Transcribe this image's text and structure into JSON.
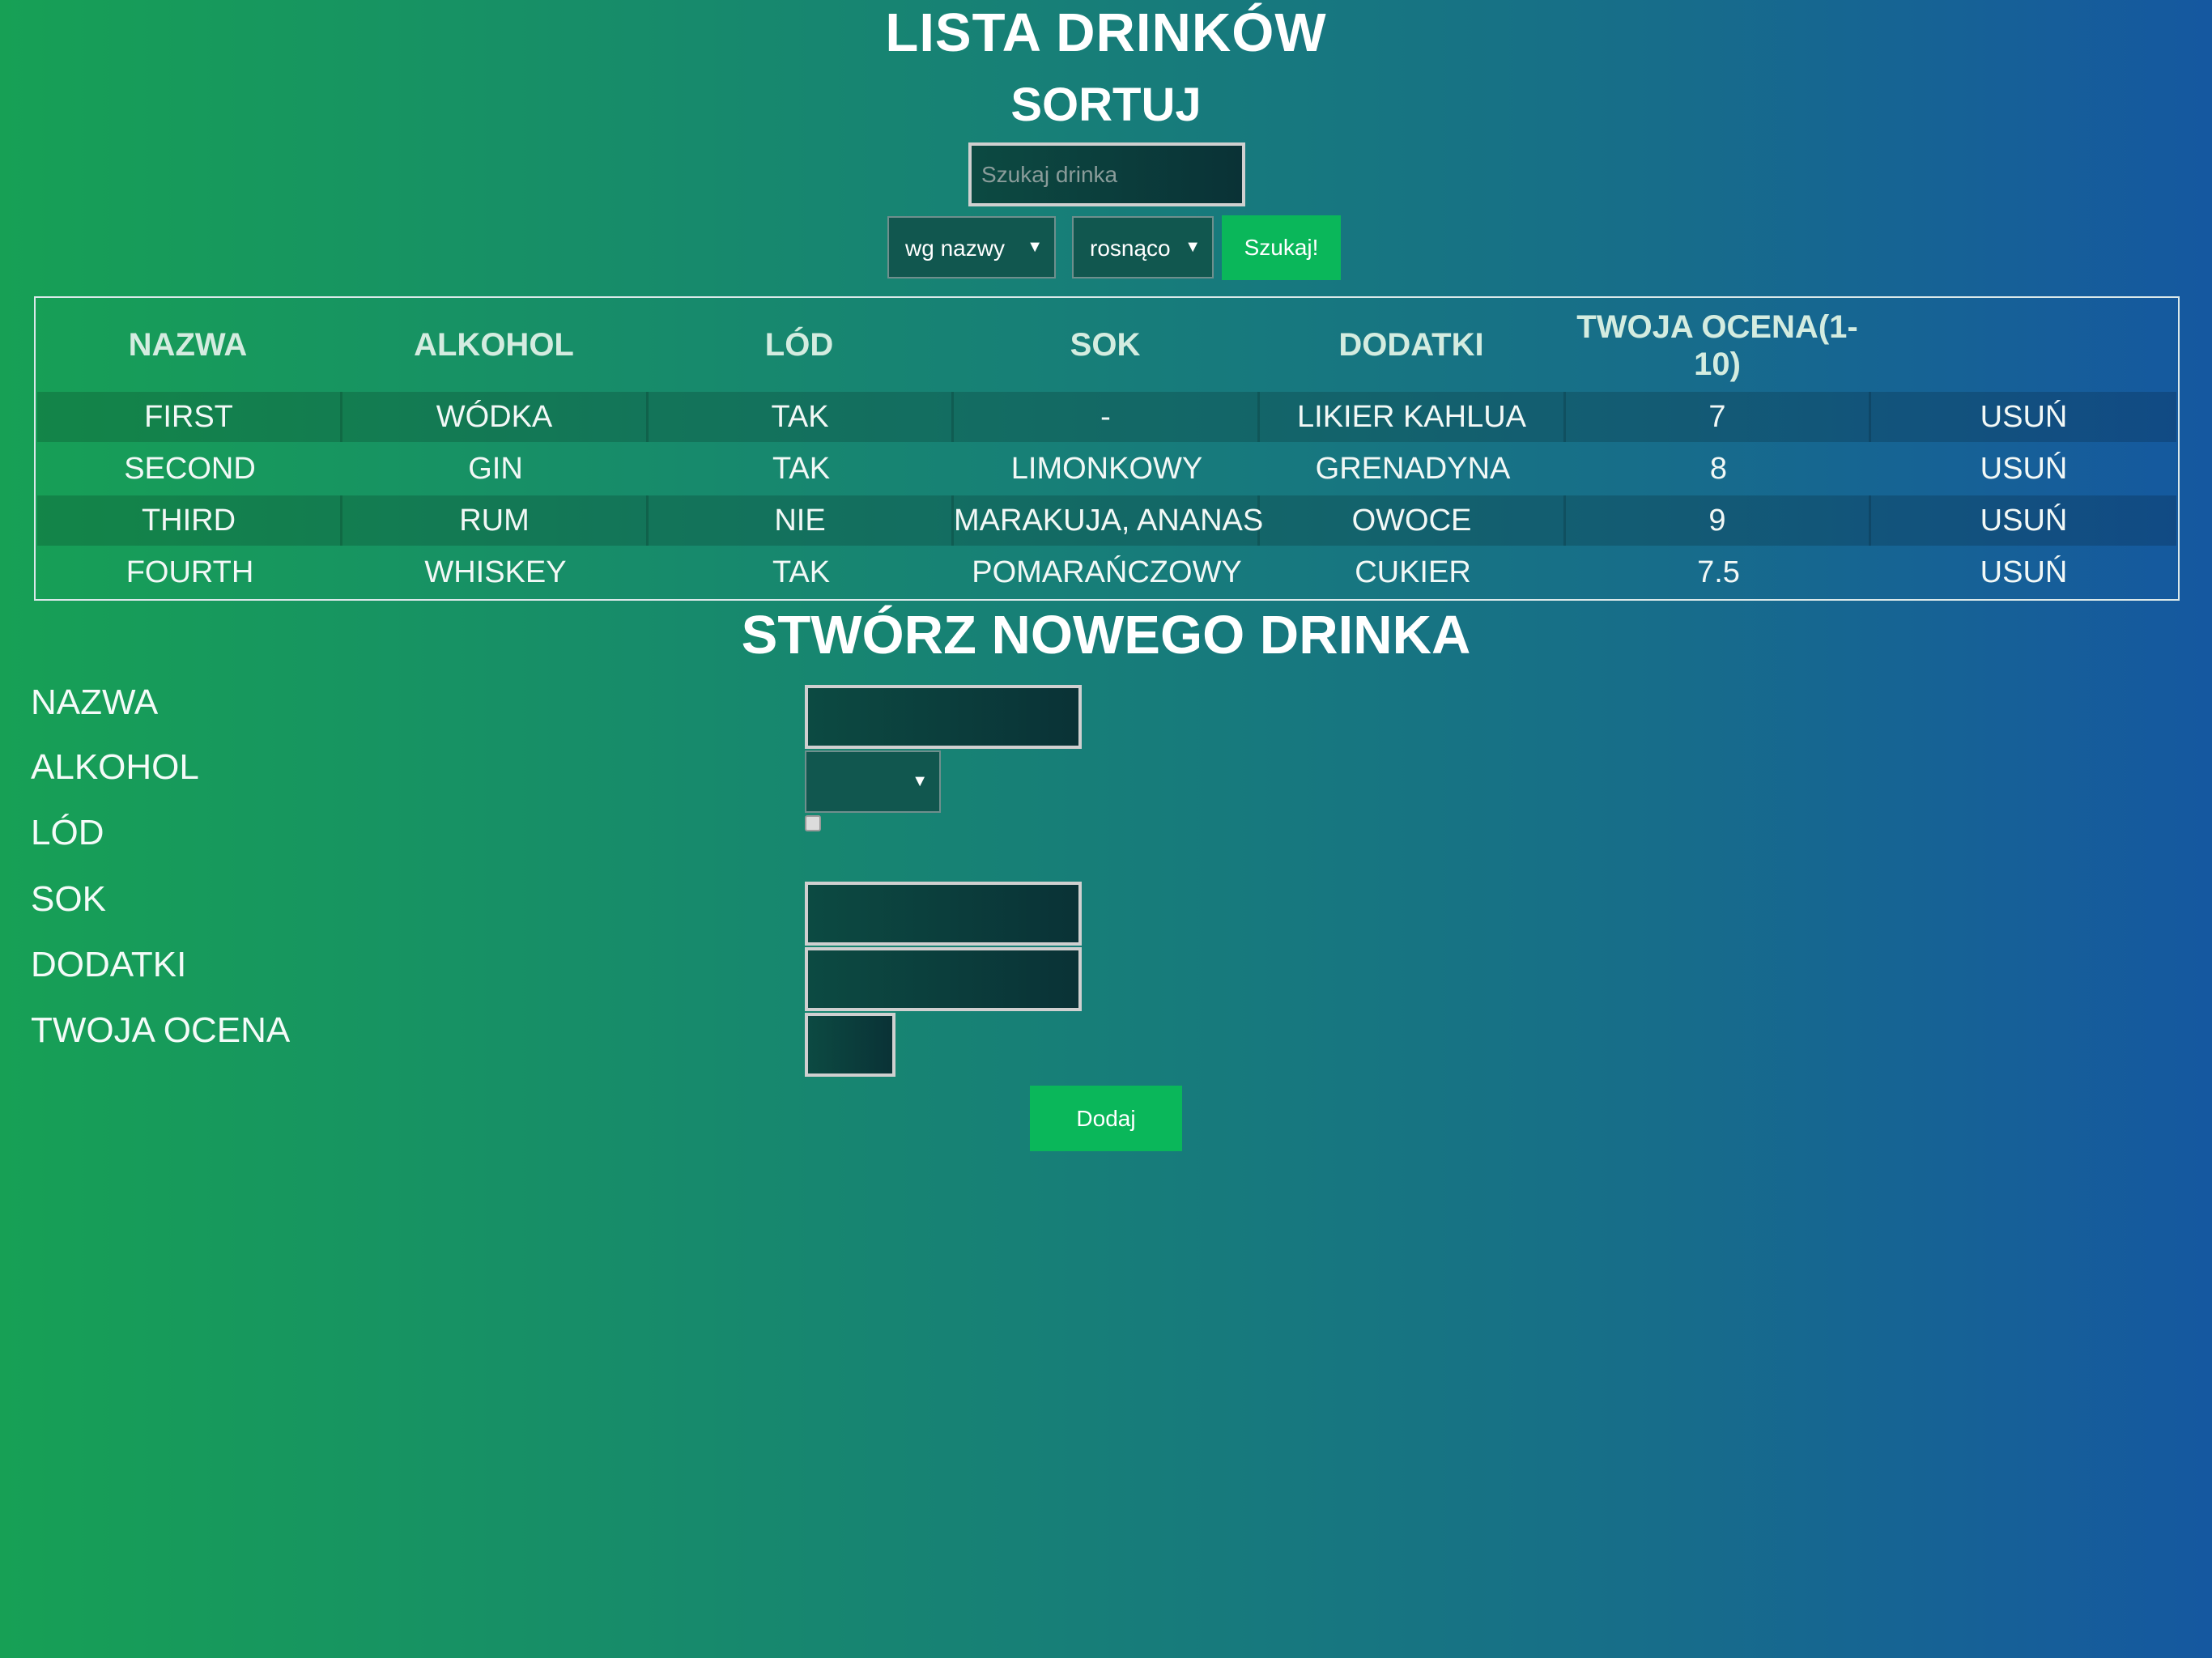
{
  "page": {
    "title": "LISTA DRINKÓW",
    "sort_title": "SORTUJ"
  },
  "search": {
    "placeholder": "Szukaj drinka",
    "sort_by": "wg nazwy",
    "order": "rosnąco",
    "button_label": "Szukaj!"
  },
  "table": {
    "headers": [
      "NAZWA",
      "ALKOHOL",
      "LÓD",
      "SOK",
      "DODATKI",
      "TWOJA OCENA(1-",
      "10)"
    ],
    "rows": [
      {
        "name": "FIRST",
        "alcohol": "WÓDKA",
        "ice": "TAK",
        "juice": "-",
        "extras": "LIKIER KAHLUA",
        "rating": "7",
        "delete": "USUŃ"
      },
      {
        "name": "SECOND",
        "alcohol": "GIN",
        "ice": "TAK",
        "juice": "LIMONKOWY",
        "extras": "GRENADYNA",
        "rating": "8",
        "delete": "USUŃ"
      },
      {
        "name": "THIRD",
        "alcohol": "RUM",
        "ice": "NIE",
        "juice": "MARAKUJA, ANANAS",
        "extras": "OWOCE",
        "rating": "9",
        "delete": "USUŃ"
      },
      {
        "name": "FOURTH",
        "alcohol": "WHISKEY",
        "ice": "TAK",
        "juice": "POMARAŃCZOWY",
        "extras": "CUKIER",
        "rating": "7.5",
        "delete": "USUŃ"
      }
    ]
  },
  "form": {
    "title": "STWÓRZ NOWEGO DRINKA",
    "labels": {
      "name": "NAZWA",
      "alcohol": "ALKOHOL",
      "ice": "LÓD",
      "juice": "SOK",
      "extras": "DODATKI",
      "rating": "TWOJA OCENA"
    },
    "submit_label": "Dodaj"
  },
  "icons": {
    "dropdown": "chevron-down-icon",
    "checkbox": "checkbox-unchecked"
  },
  "colors": {
    "accent_button": "#0ab75a",
    "gradient_start": "#17a055",
    "gradient_end": "#1558a0"
  }
}
